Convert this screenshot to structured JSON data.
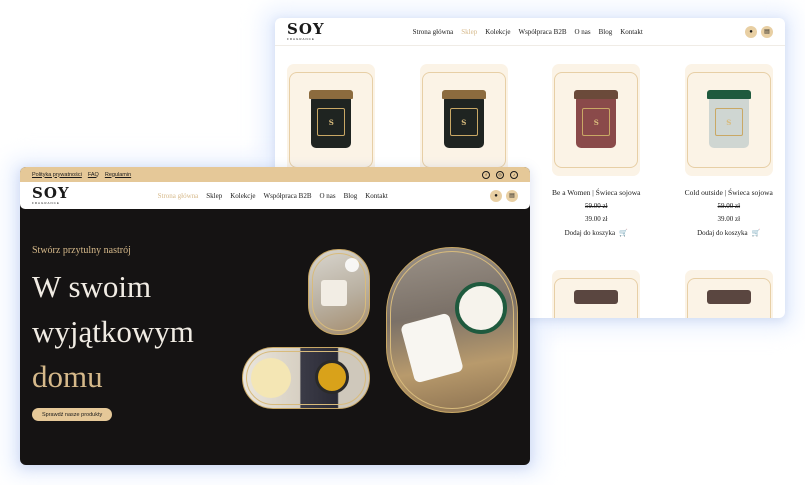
{
  "brand": {
    "logo": "SOY",
    "logo_sub": "FRAGRANCE"
  },
  "shop_window": {
    "nav": [
      {
        "label": "Strona główna",
        "active": false
      },
      {
        "label": "Sklep",
        "active": true
      },
      {
        "label": "Kolekcje",
        "active": false
      },
      {
        "label": "Współpraca B2B",
        "active": false
      },
      {
        "label": "O nas",
        "active": false
      },
      {
        "label": "Blog",
        "active": false
      },
      {
        "label": "Kontakt",
        "active": false
      }
    ],
    "products": [
      {
        "name": "",
        "old_price": "",
        "price": "",
        "add_label": "",
        "jar_color": "#1f2421",
        "lid_color": "#8c6b3e",
        "label_text": "So Lush"
      },
      {
        "name": "",
        "old_price": "",
        "price": "",
        "add_label": "",
        "jar_color": "#1f2421",
        "lid_color": "#8c6b3e",
        "label_text": "Honey"
      },
      {
        "name": "Be a Women | Świeca sojowa",
        "old_price": "59.00 zł",
        "price": "39.00 zł",
        "add_label": "Dodaj do koszyka",
        "jar_color": "#8a4a4a",
        "lid_color": "#6b4a3a",
        "label_text": "SOY"
      },
      {
        "name": "Cold outside | Świeca sojowa",
        "old_price": "59.00 zł",
        "price": "39.00 zł",
        "add_label": "Dodaj do koszyka",
        "jar_color": "#cfd6d2",
        "lid_color": "#1f5a3e",
        "label_text": "SOY"
      }
    ]
  },
  "hero_window": {
    "topbar_links": [
      "Polityka prywatności",
      "FAQ",
      "Regulamin"
    ],
    "social_icons": [
      "facebook-icon",
      "instagram-icon",
      "tiktok-icon"
    ],
    "nav": [
      {
        "label": "Strona główna",
        "active": true
      },
      {
        "label": "Sklep",
        "active": false
      },
      {
        "label": "Kolekcje",
        "active": false
      },
      {
        "label": "Współpraca B2B",
        "active": false
      },
      {
        "label": "O nas",
        "active": false
      },
      {
        "label": "Blog",
        "active": false
      },
      {
        "label": "Kontakt",
        "active": false
      }
    ],
    "tagline": "Stwórz przytulny nastrój",
    "headline_1": "W swoim",
    "headline_2": "wyjątkowym",
    "headline_3": "domu",
    "cta": "Sprawdź nasze produkty"
  },
  "colors": {
    "gold": "#d6b98a",
    "sand": "#e5c898",
    "dark": "#151313",
    "cream": "#fbf3e6"
  }
}
